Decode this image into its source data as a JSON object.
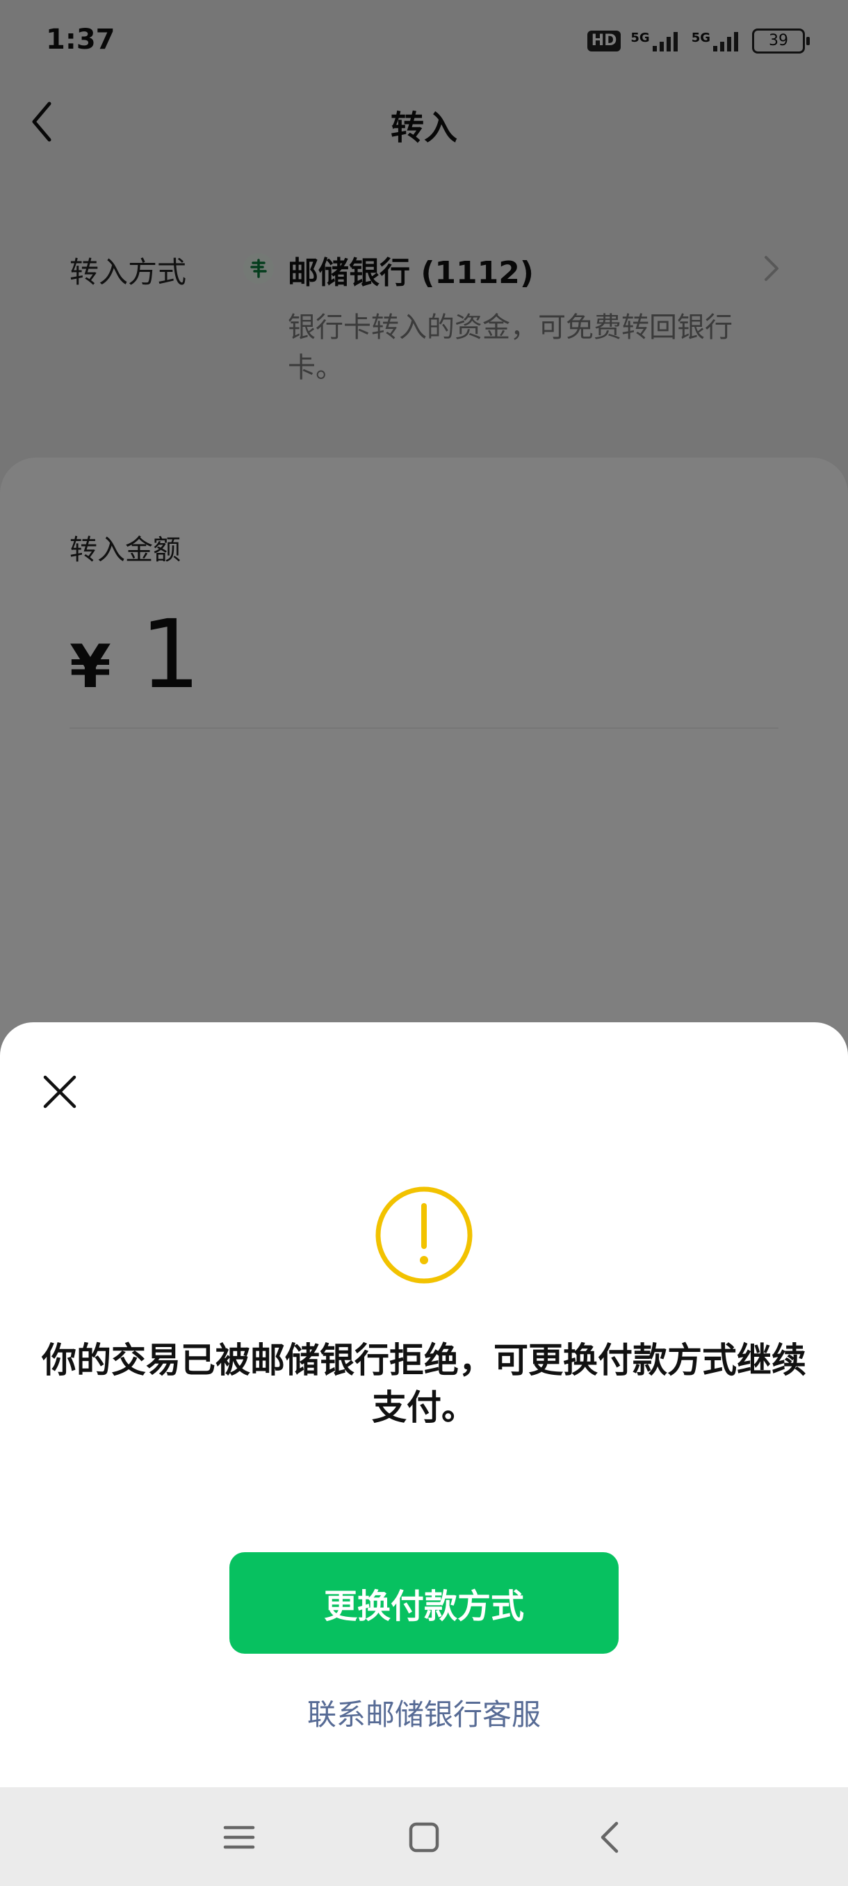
{
  "status_bar": {
    "time": "1:37",
    "hd_label": "HD",
    "network_1": "5G",
    "network_2": "5G",
    "battery": "39"
  },
  "header": {
    "title": "转入"
  },
  "transfer_method": {
    "label": "转入方式",
    "bank_name": "邮储银行 (1112)",
    "description": "银行卡转入的资金，可免费转回银行卡。"
  },
  "amount": {
    "label": "转入金额",
    "currency": "¥",
    "value": "1"
  },
  "dialog": {
    "message": "你的交易已被邮储银行拒绝，可更换付款方式继续支付。",
    "primary_button": "更换付款方式",
    "secondary_link": "联系邮储银行客服"
  },
  "colors": {
    "accent_green": "#07c160",
    "warning_yellow": "#f2c200",
    "link_blue": "#576b95"
  },
  "icons": {
    "back": "chevron-left-icon",
    "bank": "postal-bank-logo-icon",
    "chevron": "chevron-right-icon",
    "close": "close-icon",
    "warning": "warning-circle-icon",
    "nav_menu": "menu-icon",
    "nav_home": "home-square-icon",
    "nav_back": "back-triangle-icon"
  }
}
